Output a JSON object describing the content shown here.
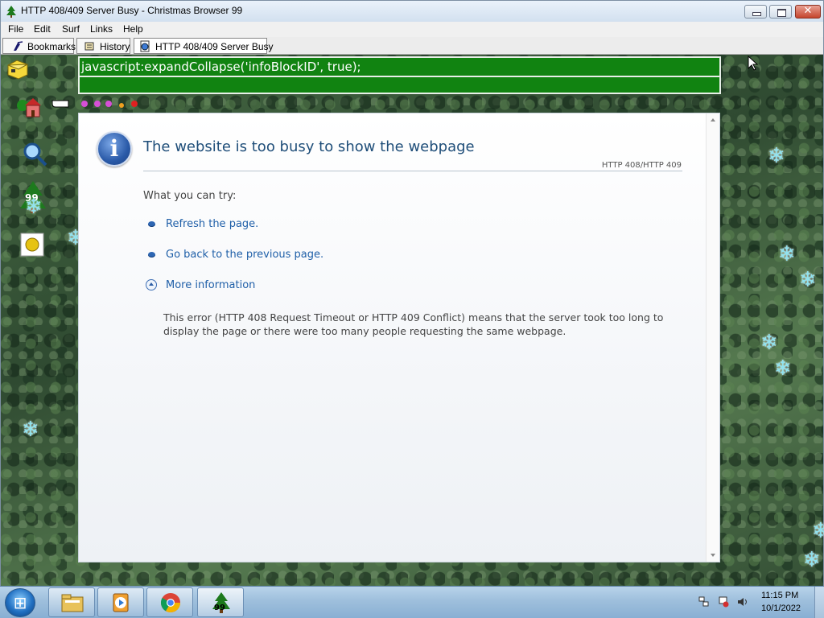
{
  "window": {
    "title": "HTTP 408/409 Server Busy - Christmas Browser 99",
    "close_glyph": "✕"
  },
  "menu": {
    "items": [
      "File",
      "Edit",
      "Surf",
      "Links",
      "Help"
    ]
  },
  "tabs": [
    {
      "label": "Bookmarks",
      "icon": "bookmark-pen-icon"
    },
    {
      "label": "History",
      "icon": "history-scroll-icon"
    },
    {
      "label": "HTTP 408/409 Server Busy",
      "icon": "globe-page-icon"
    }
  ],
  "status_bar": {
    "text": "javascript:expandCollapse('infoBlockID', true);",
    "background": "#118311"
  },
  "side_toolbar": {
    "badge_text": "99",
    "icons": [
      "mailbox-icon",
      "home-icon",
      "pointing-hand-lights-icon",
      "magnifier-icon",
      "christmas-tree-99-icon",
      "sun-stamp-icon"
    ]
  },
  "error_page": {
    "heading": "The website is too busy to show the webpage",
    "error_code": "HTTP 408/HTTP 409",
    "try_label": "What you can try:",
    "links": [
      "Refresh the page.",
      "Go back to the previous page."
    ],
    "more_info": "More information",
    "description": "This error (HTTP 408 Request Timeout or HTTP 409 Conflict) means that the server took too long to display the page or there were too many people requesting the same webpage.",
    "info_glyph": "i",
    "heading_color": "#1f4e79",
    "link_color": "#1f5fa8"
  },
  "taskbar": {
    "start_glyph": "⊞",
    "apps": [
      "explorer-folder-icon",
      "media-player-icon",
      "chrome-icon",
      "christmas-tree-99-icon"
    ],
    "app_badge": "99",
    "clock_time": "11:15 PM",
    "clock_date": "10/1/2022",
    "tray_icons": [
      "network-icon",
      "action-center-flag-icon",
      "volume-icon"
    ]
  }
}
